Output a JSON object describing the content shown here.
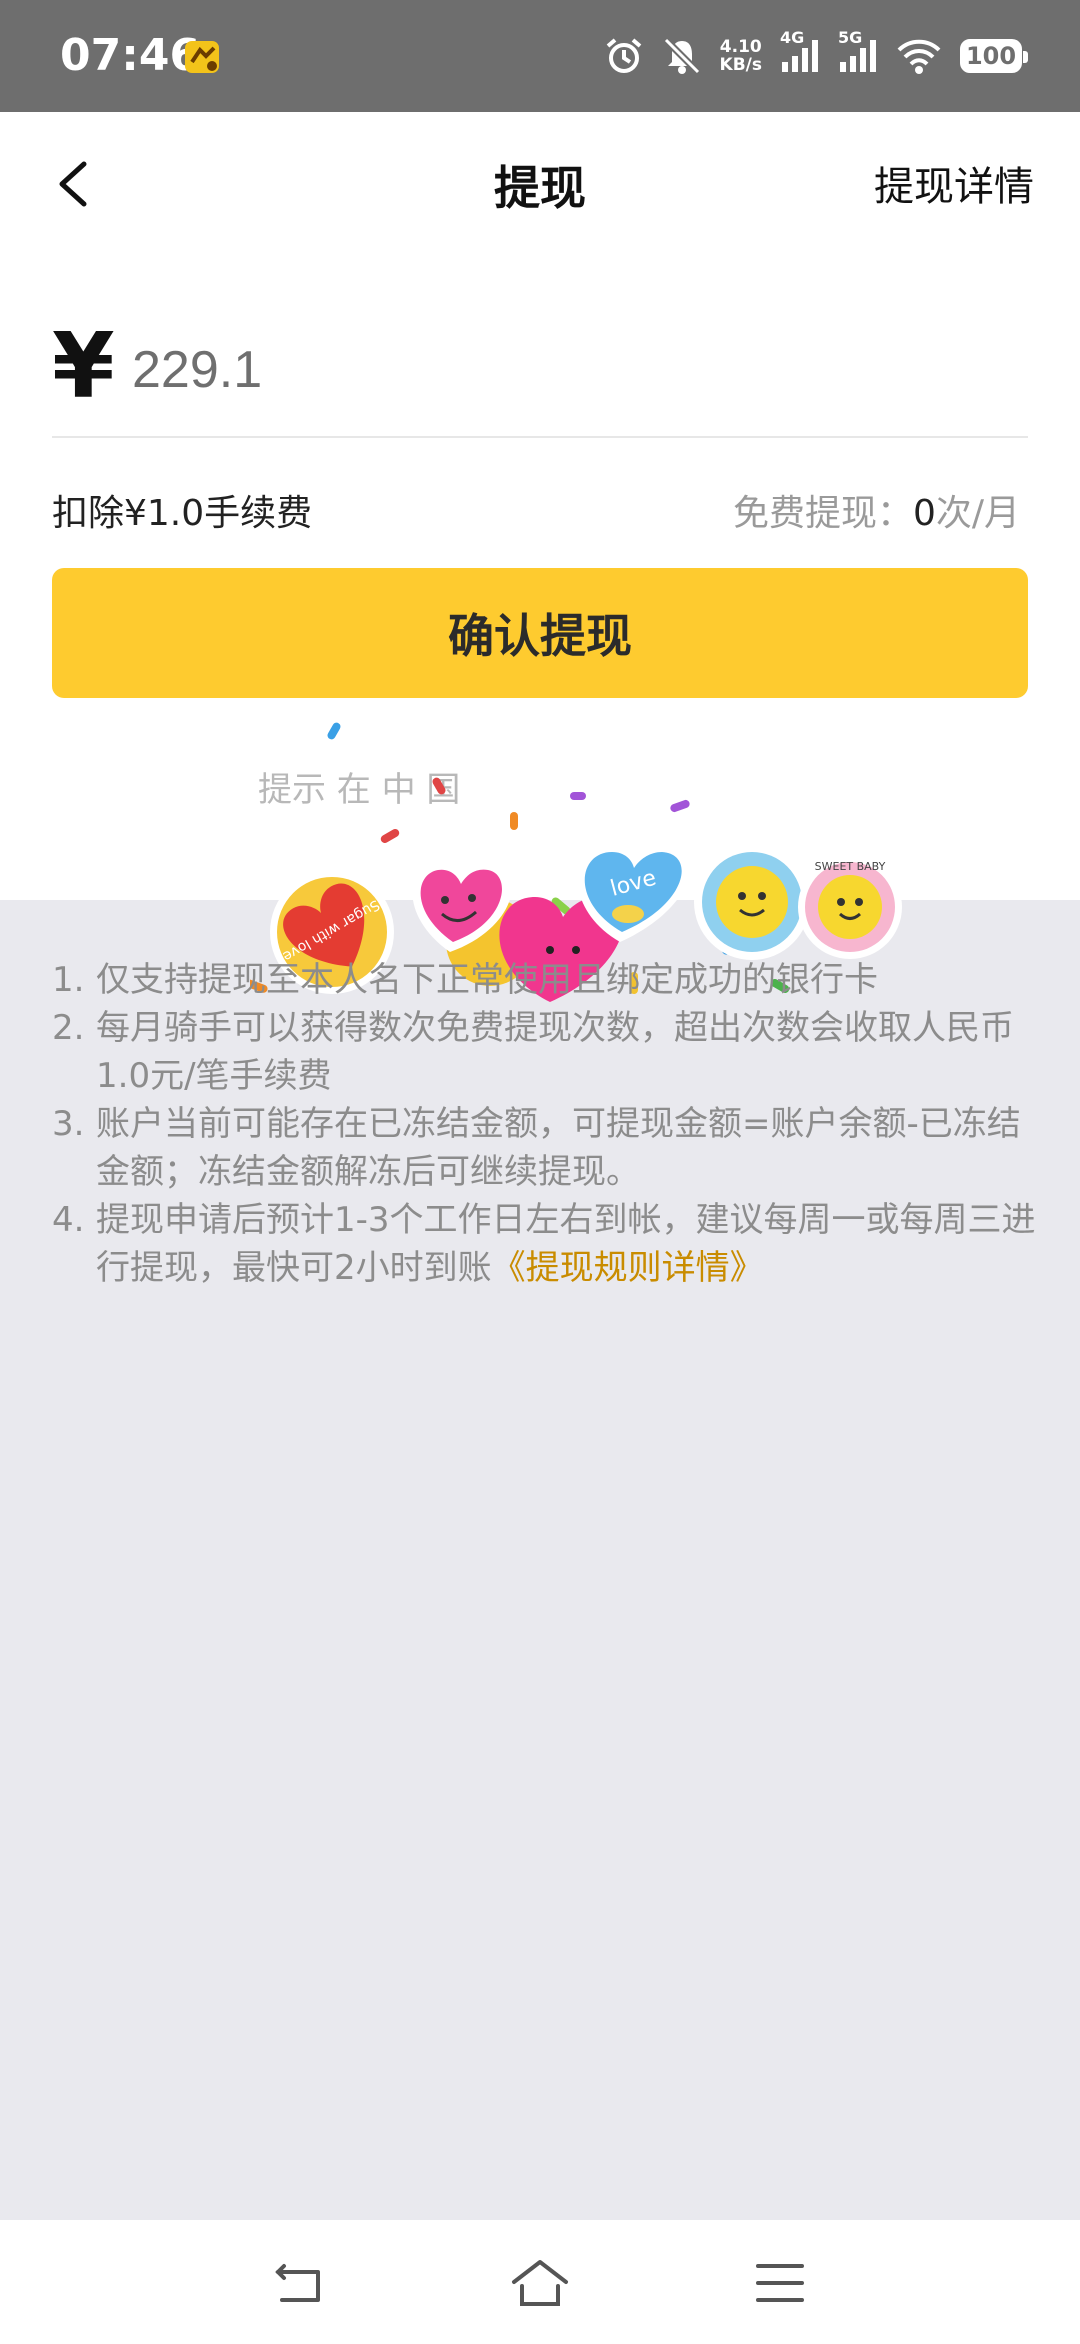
{
  "status_bar": {
    "time": "07:46",
    "net_speed_value": "4.10",
    "net_speed_unit": "KB/s",
    "signal1_label": "4G",
    "signal2_label": "5G",
    "battery": "100"
  },
  "header": {
    "title": "提现",
    "details_link": "提现详情"
  },
  "withdraw": {
    "currency_symbol": "¥",
    "amount": "229.1",
    "fee_text": "扣除¥1.0手续费",
    "free_label": "免费提现：",
    "free_count": "0",
    "free_unit": "次/月",
    "confirm_label": "确认提现",
    "tip_text": "提示 在 中 国"
  },
  "rules": [
    {
      "idx": "1.",
      "text": "仅支持提现至本人名下正常使用且绑定成功的银行卡"
    },
    {
      "idx": "2.",
      "text": "每月骑手可以获得数次免费提现次数，超出次数会收取人民币1.0元/笔手续费"
    },
    {
      "idx": "3.",
      "text": "账户当前可能存在已冻结金额，可提现金额=账户余额-已冻结金额；冻结金额解冻后可继续提现。"
    },
    {
      "idx": "4.",
      "text": "提现申请后预计1-3个工作日左右到帐，建议每周一或每周三进行提现，最快可2小时到账",
      "link": "《提现规则详情》"
    }
  ],
  "stickers": {
    "sticker1_text": "Sugar with love",
    "sticker3_text": "love",
    "sticker4_text": "SWEET BABY"
  },
  "colors": {
    "accent": "#fecb2f",
    "link": "#c98c00",
    "status_bar_bg": "#6e6e6e",
    "page_bg": "#e9e9ee"
  }
}
